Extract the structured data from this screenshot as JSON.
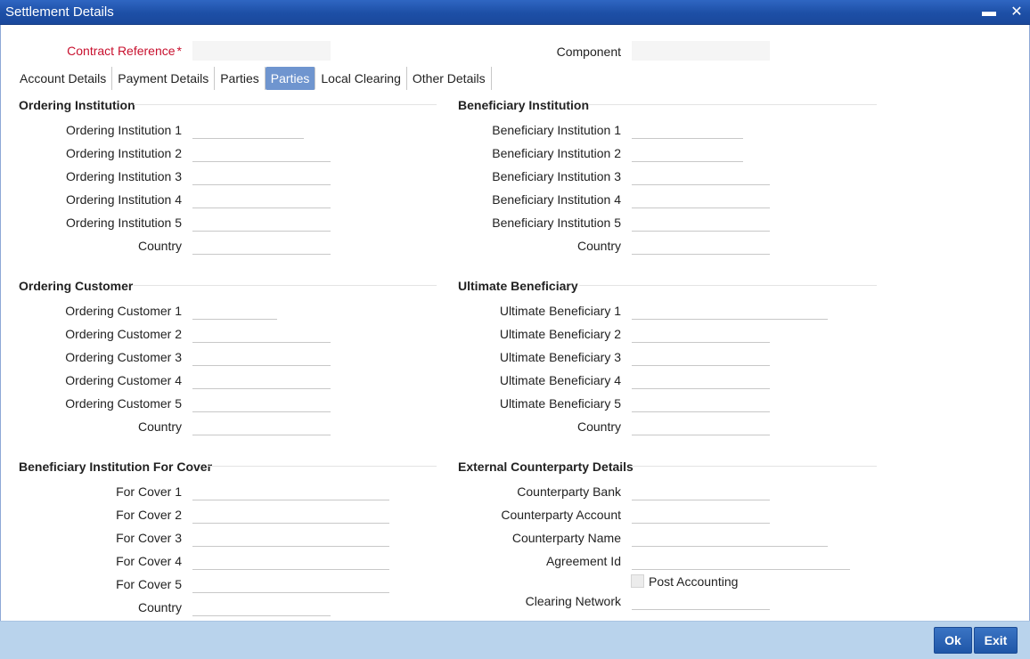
{
  "window": {
    "title": "Settlement Details",
    "minimize_glyph": "▬",
    "close_glyph": "✕"
  },
  "header": {
    "contract_reference_label": "Contract Reference",
    "required_mark": "*",
    "contract_reference_value": "",
    "component_label": "Component",
    "component_value": ""
  },
  "tabs": [
    {
      "label": "Account Details",
      "active": false
    },
    {
      "label": "Payment Details",
      "active": false
    },
    {
      "label": "Parties",
      "active": false
    },
    {
      "label": "Parties",
      "active": true
    },
    {
      "label": "Local Clearing",
      "active": false
    },
    {
      "label": "Other Details",
      "active": false
    }
  ],
  "ordering_institution": {
    "title": "Ordering Institution",
    "fields": [
      {
        "label": "Ordering Institution 1",
        "value": ""
      },
      {
        "label": "Ordering Institution 2",
        "value": ""
      },
      {
        "label": "Ordering Institution 3",
        "value": ""
      },
      {
        "label": "Ordering Institution 4",
        "value": ""
      },
      {
        "label": "Ordering Institution 5",
        "value": ""
      },
      {
        "label": "Country",
        "value": ""
      }
    ]
  },
  "beneficiary_institution": {
    "title": "Beneficiary Institution",
    "fields": [
      {
        "label": "Beneficiary Institution 1",
        "value": ""
      },
      {
        "label": "Beneficiary Institution 2",
        "value": ""
      },
      {
        "label": "Beneficiary Institution 3",
        "value": ""
      },
      {
        "label": "Beneficiary Institution 4",
        "value": ""
      },
      {
        "label": "Beneficiary Institution 5",
        "value": ""
      },
      {
        "label": "Country",
        "value": ""
      }
    ]
  },
  "ordering_customer": {
    "title": "Ordering Customer",
    "fields": [
      {
        "label": "Ordering Customer 1",
        "value": ""
      },
      {
        "label": "Ordering Customer 2",
        "value": ""
      },
      {
        "label": "Ordering Customer 3",
        "value": ""
      },
      {
        "label": "Ordering Customer 4",
        "value": ""
      },
      {
        "label": "Ordering Customer 5",
        "value": ""
      },
      {
        "label": "Country",
        "value": ""
      }
    ]
  },
  "ultimate_beneficiary": {
    "title": "Ultimate Beneficiary",
    "fields": [
      {
        "label": "Ultimate Beneficiary 1",
        "value": ""
      },
      {
        "label": "Ultimate Beneficiary 2",
        "value": ""
      },
      {
        "label": "Ultimate Beneficiary 3",
        "value": ""
      },
      {
        "label": "Ultimate Beneficiary 4",
        "value": ""
      },
      {
        "label": "Ultimate Beneficiary 5",
        "value": ""
      },
      {
        "label": "Country",
        "value": ""
      }
    ]
  },
  "beneficiary_institution_cover": {
    "title": "Beneficiary Institution For Cover",
    "fields": [
      {
        "label": "For Cover 1",
        "value": ""
      },
      {
        "label": "For Cover 2",
        "value": ""
      },
      {
        "label": "For Cover 3",
        "value": ""
      },
      {
        "label": "For Cover 4",
        "value": ""
      },
      {
        "label": "For Cover 5",
        "value": ""
      },
      {
        "label": "Country",
        "value": ""
      }
    ]
  },
  "external_counterparty": {
    "title": "External Counterparty Details",
    "fields": [
      {
        "label": "Counterparty Bank",
        "value": ""
      },
      {
        "label": "Counterparty Account",
        "value": ""
      },
      {
        "label": "Counterparty Name",
        "value": ""
      },
      {
        "label": "Agreement Id",
        "value": ""
      }
    ],
    "post_accounting_label": "Post Accounting",
    "post_accounting_checked": false,
    "clearing_network_label": "Clearing Network",
    "clearing_network_value": ""
  },
  "footer": {
    "ok_label": "Ok",
    "exit_label": "Exit"
  }
}
